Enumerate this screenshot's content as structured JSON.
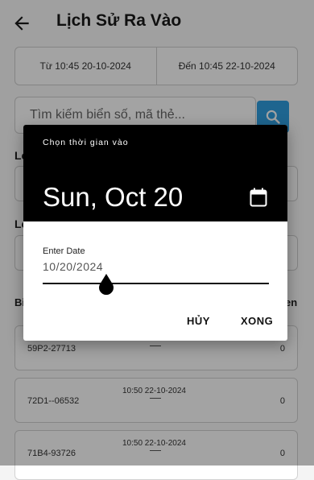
{
  "header": {
    "title": "Lịch Sử Ra Vào"
  },
  "date_range": {
    "from": "Từ 10:45 20-10-2024",
    "to": "Đến 10:45 22-10-2024"
  },
  "search": {
    "placeholder": "Tìm kiếm biển số, mã thẻ..."
  },
  "sections": {
    "first": "Lo",
    "second": "Lo"
  },
  "columns": {
    "left": "Bi",
    "right": "en"
  },
  "records": [
    {
      "plate": "59P2-27713",
      "time": "",
      "fee": "0"
    },
    {
      "plate": "72D1--06532",
      "time": "10:50 22-10-2024",
      "fee": "0"
    },
    {
      "plate": "71B4-93726",
      "time": "10:50 22-10-2024",
      "fee": "0"
    }
  ],
  "dialog": {
    "caption": "Chọn thời gian vào",
    "selected_date": "Sun, Oct 20",
    "input_label": "Enter Date",
    "input_value": "10/20/2024",
    "cancel_label": "HỦY",
    "confirm_label": "XONG"
  },
  "colors": {
    "accent": "#2f9fe0",
    "dialog_header": "#000000"
  }
}
